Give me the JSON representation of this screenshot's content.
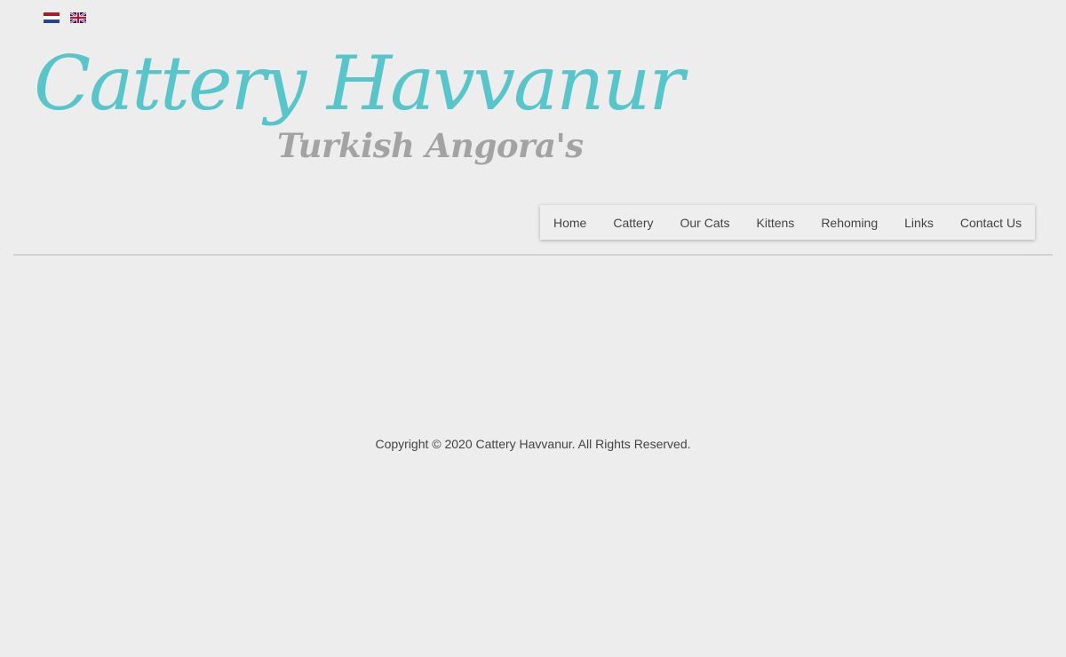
{
  "languages": [
    {
      "code": "nl",
      "icon": "dutch-flag-icon"
    },
    {
      "code": "en",
      "icon": "uk-flag-icon"
    }
  ],
  "logo": {
    "title": "Cattery Havvanur",
    "subtitle": "Turkish Angora's",
    "title_color": "#57c5c9",
    "subtitle_color": "#a3a3a3"
  },
  "nav": {
    "items": [
      {
        "label": "Home"
      },
      {
        "label": "Cattery"
      },
      {
        "label": "Our Cats"
      },
      {
        "label": "Kittens"
      },
      {
        "label": "Rehoming"
      },
      {
        "label": "Links"
      },
      {
        "label": "Contact Us"
      }
    ]
  },
  "footer": {
    "copyright": "Copyright © 2020 Cattery Havvanur. All Rights Reserved."
  },
  "colors": {
    "background": "#ededed",
    "text": "#444444",
    "accent": "#57c5c9"
  }
}
